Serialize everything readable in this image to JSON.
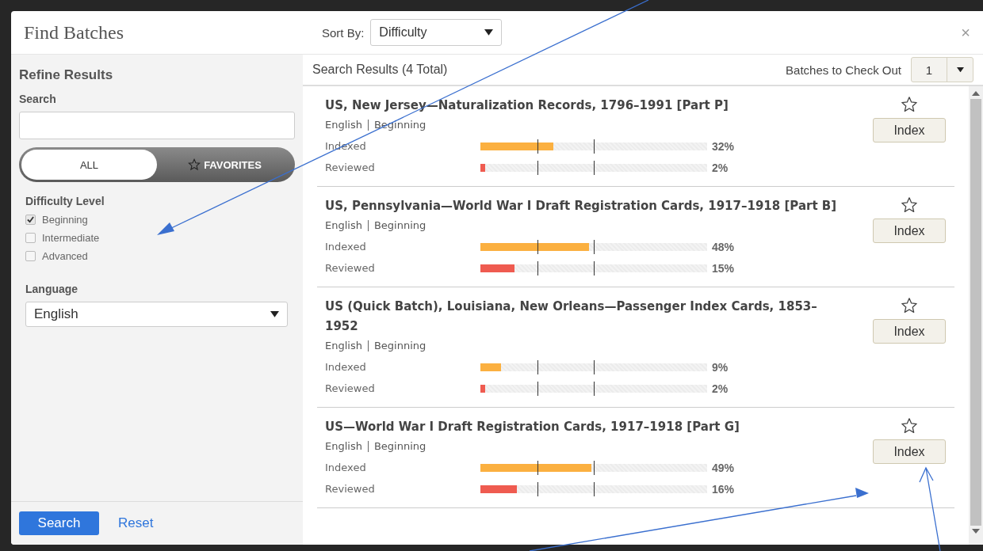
{
  "dialog": {
    "title": "Find Batches",
    "sort": {
      "label": "Sort By:",
      "value": "Difficulty"
    },
    "close": "×"
  },
  "sidebar": {
    "heading": "Refine Results",
    "search_label": "Search",
    "toggle": [
      {
        "label": "ALL",
        "selected": true
      },
      {
        "label": "FAVORITES",
        "selected": false
      }
    ],
    "difficulty": {
      "heading": "Difficulty Level",
      "options": [
        {
          "label": "Beginning",
          "checked": true
        },
        {
          "label": "Intermediate",
          "checked": false
        },
        {
          "label": "Advanced",
          "checked": false
        }
      ]
    },
    "language": {
      "heading": "Language",
      "value": "English"
    },
    "actions": {
      "search": "Search",
      "reset": "Reset"
    }
  },
  "results": {
    "summary": "Search Results (4 Total)",
    "checkout_label": "Batches to Check Out",
    "checkout_value": "1",
    "batches": [
      {
        "title": "US, New Jersey—Naturalization Records, 1796–1991 [Part P]",
        "language": "English",
        "difficulty": "Beginning",
        "favorite": false,
        "action": "Index",
        "progress": [
          {
            "kind": "indexed",
            "label": "Indexed",
            "level": 0.32,
            "reading": "32%"
          },
          {
            "kind": "reviewed",
            "label": "Reviewed",
            "level": 0.02,
            "reading": "2%"
          }
        ]
      },
      {
        "title": "US, Pennsylvania—World War I Draft Registration Cards, 1917–1918 [Part B]",
        "language": "English",
        "difficulty": "Beginning",
        "favorite": false,
        "action": "Index",
        "progress": [
          {
            "kind": "indexed",
            "label": "Indexed",
            "level": 0.48,
            "reading": "48%"
          },
          {
            "kind": "reviewed",
            "label": "Reviewed",
            "level": 0.15,
            "reading": "15%"
          }
        ]
      },
      {
        "title": "US (Quick Batch), Louisiana, New Orleans—Passenger Index Cards, 1853–1952",
        "language": "English",
        "difficulty": "Beginning",
        "favorite": false,
        "action": "Index",
        "progress": [
          {
            "kind": "indexed",
            "label": "Indexed",
            "level": 0.09,
            "reading": "9%"
          },
          {
            "kind": "reviewed",
            "label": "Reviewed",
            "level": 0.02,
            "reading": "2%"
          }
        ]
      },
      {
        "title": "US—World War I Draft Registration Cards, 1917–1918 [Part G]",
        "language": "English",
        "difficulty": "Beginning",
        "favorite": false,
        "action": "Index",
        "progress": [
          {
            "kind": "indexed",
            "label": "Indexed",
            "level": 0.49,
            "reading": "49%"
          },
          {
            "kind": "reviewed",
            "label": "Reviewed",
            "level": 0.16,
            "reading": "16%"
          }
        ]
      }
    ]
  }
}
